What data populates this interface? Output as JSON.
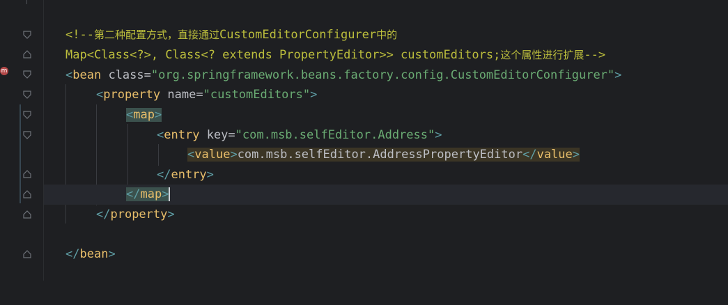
{
  "editor": {
    "language": "xml",
    "lines": [
      {
        "comment_prefix": "<!--",
        "comment_cjk_1": "第二种配置方式，直接通过",
        "comment_ascii_1": "CustomEditorConfigurer",
        "comment_cjk_2": "中的"
      },
      {
        "comment_ascii": "Map<Class<?>, Class<? extends PropertyEditor>> customEditors;",
        "comment_cjk": "这个属性进行扩展",
        "comment_suffix": "-->"
      },
      {
        "open": "<",
        "tag": "bean",
        "attr": "class",
        "eq": "=",
        "value": "\"org.springframework.beans.factory.config.CustomEditorConfigurer\"",
        "close": ">"
      },
      {
        "open": "<",
        "tag": "property",
        "attr": "name",
        "eq": "=",
        "value": "\"customEditors\"",
        "close": ">"
      },
      {
        "open": "<",
        "tag": "map",
        "close": ">"
      },
      {
        "open": "<",
        "tag": "entry",
        "attr": "key",
        "eq": "=",
        "value": "\"com.msb.selfEditor.Address\"",
        "close": ">"
      },
      {
        "open": "<",
        "tag": "value",
        "close": ">",
        "text": "com.msb.selfEditor.AddressPropertyEditor",
        "end_open": "</",
        "end_tag": "value",
        "end_close": ">"
      },
      {
        "end_open": "</",
        "end_tag": "entry",
        "end_close": ">"
      },
      {
        "end_open": "</",
        "end_tag": "map",
        "end_close": ">"
      },
      {
        "end_open": "</",
        "end_tag": "property",
        "end_close": ">"
      },
      {
        "end_open": "</",
        "end_tag": "bean",
        "end_close": ">"
      }
    ]
  },
  "gutter": {
    "annotation_badge": "m"
  },
  "colors": {
    "background": "#1e1f22",
    "comment": "#bcbe3c",
    "tag": "#e8be6a",
    "bracket": "#5f9ea5",
    "string": "#6aab73",
    "attribute": "#bcbec4",
    "match_highlight": "#3b514d",
    "value_highlight": "#3b3525"
  }
}
